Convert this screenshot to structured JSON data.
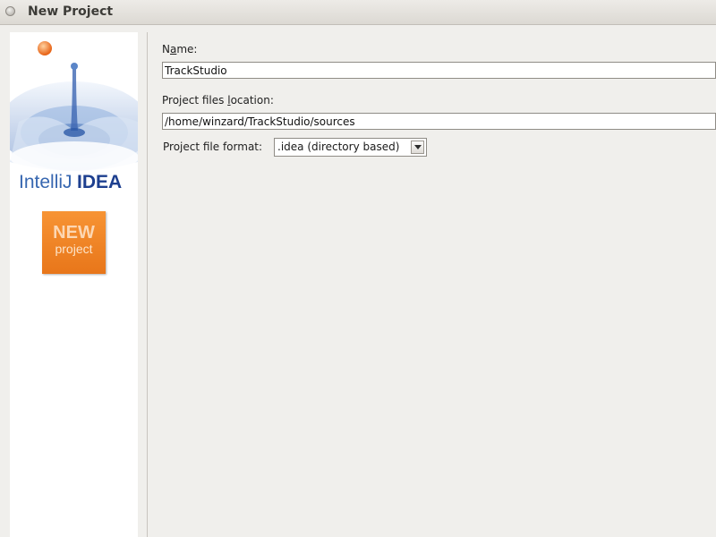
{
  "window": {
    "title": "New Project"
  },
  "sidebar": {
    "logo_text_intellij": "IntelliJ",
    "logo_text_idea": "IDEA",
    "badge_title": "NEW",
    "badge_subtitle": "project"
  },
  "form": {
    "name_label_first": "N",
    "name_label_mnemonic": "a",
    "name_label_rest": "me:",
    "name_value": "TrackStudio",
    "location_label_first": "Project files ",
    "location_label_mnemonic": "l",
    "location_label_rest": "ocation:",
    "location_value": "/home/winzard/TrackStudio/sources",
    "format_label": "Project file format:",
    "format_value": ".idea (directory based)"
  },
  "colors": {
    "badge_orange": "#f0821f",
    "logo_blue": "#1f4f9c",
    "drop_orange": "#f07d1a"
  }
}
